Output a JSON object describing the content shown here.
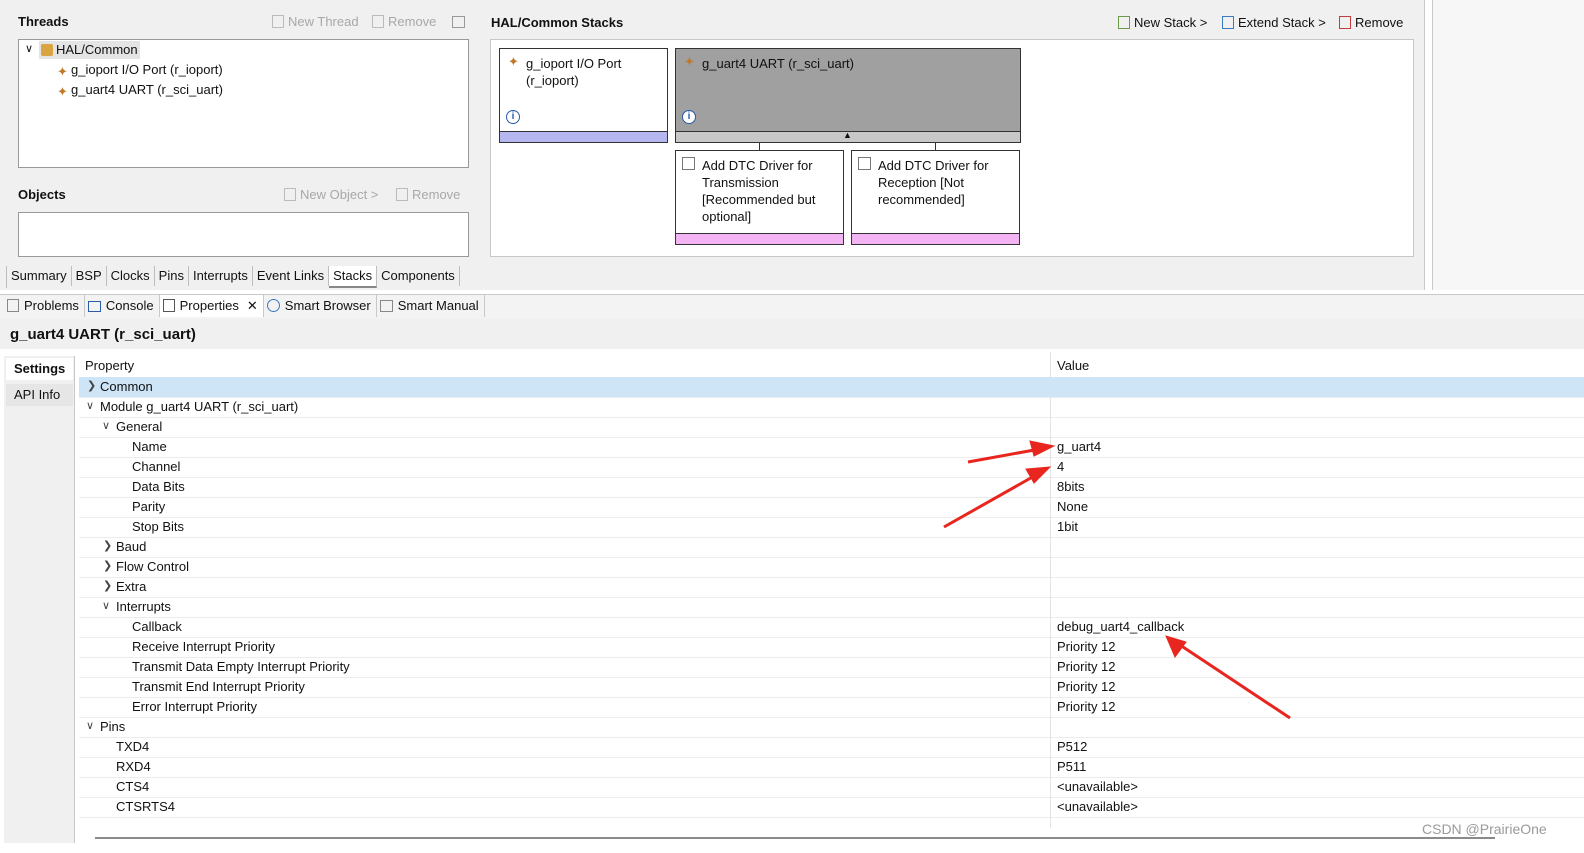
{
  "threads": {
    "title": "Threads",
    "new_thread": "New Thread",
    "remove": "Remove",
    "tree": [
      {
        "label": "HAL/Common"
      },
      {
        "label": "g_ioport I/O Port (r_ioport)"
      },
      {
        "label": "g_uart4 UART (r_sci_uart)"
      }
    ]
  },
  "objects": {
    "title": "Objects",
    "new_object": "New Object >",
    "remove": "Remove"
  },
  "stacks": {
    "title": "HAL/Common Stacks",
    "new_stack": "New Stack >",
    "extend_stack": "Extend Stack >",
    "remove": "Remove",
    "ioport_box": "g_ioport I/O Port (r_ioport)",
    "uart_box": "g_uart4 UART (r_sci_uart)",
    "dtc_tx": "Add DTC Driver for Transmission [Recommended but optional]",
    "dtc_rx": "Add DTC Driver for Reception [Not recommended]",
    "colors": {
      "uart_fill": "#a0a0a0",
      "ioport_bar": "#b6b6f0",
      "dtc_bar": "#f4b4f4"
    }
  },
  "config_tabs": [
    "Summary",
    "BSP",
    "Clocks",
    "Pins",
    "Interrupts",
    "Event Links",
    "Stacks",
    "Components"
  ],
  "view_tabs": [
    "Problems",
    "Console",
    "Properties",
    "Smart Browser",
    "Smart Manual"
  ],
  "properties": {
    "title": "g_uart4 UART (r_sci_uart)",
    "side_tabs": [
      "Settings",
      "API Info"
    ],
    "col_property": "Property",
    "col_value": "Value",
    "rows": [
      {
        "label": "Common",
        "value": "",
        "expander": ">"
      },
      {
        "label": "Module g_uart4 UART (r_sci_uart)",
        "value": "",
        "expander": "v"
      },
      {
        "label": "General",
        "value": "",
        "expander": "v"
      },
      {
        "label": "Name",
        "value": "g_uart4",
        "expander": ""
      },
      {
        "label": "Channel",
        "value": "4",
        "expander": ""
      },
      {
        "label": "Data Bits",
        "value": "8bits",
        "expander": ""
      },
      {
        "label": "Parity",
        "value": "None",
        "expander": ""
      },
      {
        "label": "Stop Bits",
        "value": "1bit",
        "expander": ""
      },
      {
        "label": "Baud",
        "value": "",
        "expander": ">"
      },
      {
        "label": "Flow Control",
        "value": "",
        "expander": ">"
      },
      {
        "label": "Extra",
        "value": "",
        "expander": ">"
      },
      {
        "label": "Interrupts",
        "value": "",
        "expander": "v"
      },
      {
        "label": "Callback",
        "value": "debug_uart4_callback",
        "expander": ""
      },
      {
        "label": "Receive Interrupt Priority",
        "value": "Priority 12",
        "expander": ""
      },
      {
        "label": "Transmit Data Empty Interrupt Priority",
        "value": "Priority 12",
        "expander": ""
      },
      {
        "label": "Transmit End Interrupt Priority",
        "value": "Priority 12",
        "expander": ""
      },
      {
        "label": "Error Interrupt Priority",
        "value": "Priority 12",
        "expander": ""
      },
      {
        "label": "Pins",
        "value": "",
        "expander": "v"
      },
      {
        "label": "TXD4",
        "value": "P512",
        "expander": ""
      },
      {
        "label": "RXD4",
        "value": "P511",
        "expander": ""
      },
      {
        "label": "CTS4",
        "value": "<unavailable>",
        "expander": ""
      },
      {
        "label": "CTSRTS4",
        "value": "<unavailable>",
        "expander": ""
      }
    ]
  },
  "watermark": "CSDN @PrairieOne",
  "annotation_color": "#e8261f"
}
